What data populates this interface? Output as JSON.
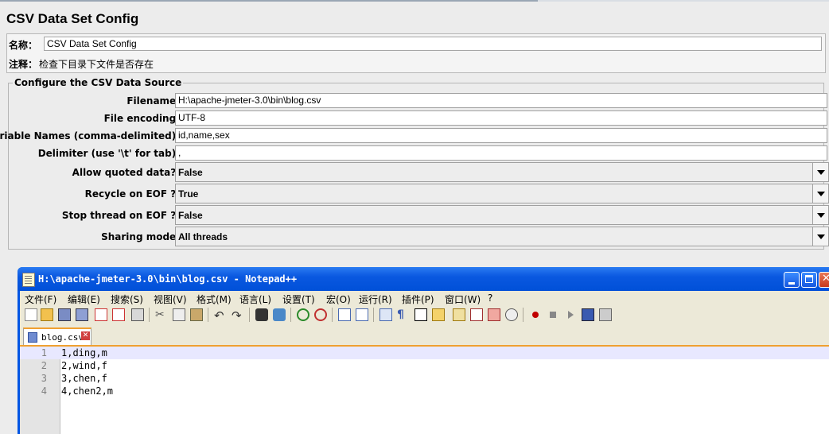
{
  "panel": {
    "title": "CSV Data Set Config",
    "name_label": "名称：",
    "name_value": "CSV Data Set Config",
    "comment_label": "注释：",
    "comment_value": "检查下目录下文件是否存在",
    "group_title": "Configure the CSV Data Source",
    "fields": {
      "filename_label": "Filename:",
      "filename_value": "H:\\apache-jmeter-3.0\\bin\\blog.csv",
      "encoding_label": "File encoding:",
      "encoding_value": "UTF-8",
      "varnames_label": "Variable Names (comma-delimited):",
      "varnames_value": "id,name,sex",
      "delimiter_label": "Delimiter (use '\\t' for tab):",
      "delimiter_value": ",",
      "quoted_label": "Allow quoted data?:",
      "quoted_value": "False",
      "recycle_label": "Recycle on EOF ?:",
      "recycle_value": "True",
      "stopthread_label": "Stop thread on EOF ?:",
      "stopthread_value": "False",
      "sharing_label": "Sharing mode:",
      "sharing_value": "All threads"
    }
  },
  "notepad": {
    "window_title": "H:\\apache-jmeter-3.0\\bin\\blog.csv - Notepad++",
    "menu": [
      "文件(F)",
      "编辑(E)",
      "搜索(S)",
      "视图(V)",
      "格式(M)",
      "语言(L)",
      "设置(T)",
      "宏(O)",
      "运行(R)",
      "插件(P)",
      "窗口(W)",
      "?"
    ],
    "tab_label": "blog.csv",
    "lines": [
      {
        "num": "1",
        "text": "1,ding,m"
      },
      {
        "num": "2",
        "text": "2,wind,f"
      },
      {
        "num": "3",
        "text": "3,chen,f"
      },
      {
        "num": "4",
        "text": "4,chen2,m"
      }
    ]
  },
  "icons": [
    "new-file-icon",
    "open-file-icon",
    "save-icon",
    "save-all-icon",
    "close-icon",
    "close-all-icon",
    "print-icon",
    "cut-icon",
    "copy-icon",
    "paste-icon",
    "undo-icon",
    "redo-icon",
    "find-icon",
    "replace-icon",
    "zoom-in-icon",
    "zoom-out-icon",
    "sync-v-icon",
    "sync-h-icon",
    "wrap-icon",
    "all-chars-icon",
    "indent-guide-icon",
    "user-lang-icon",
    "doc-map-icon",
    "function-list-icon",
    "folder-icon",
    "monitor-icon",
    "record-macro-icon",
    "stop-macro-icon",
    "play-macro-icon",
    "run-macro-multi-icon",
    "save-macro-icon"
  ]
}
